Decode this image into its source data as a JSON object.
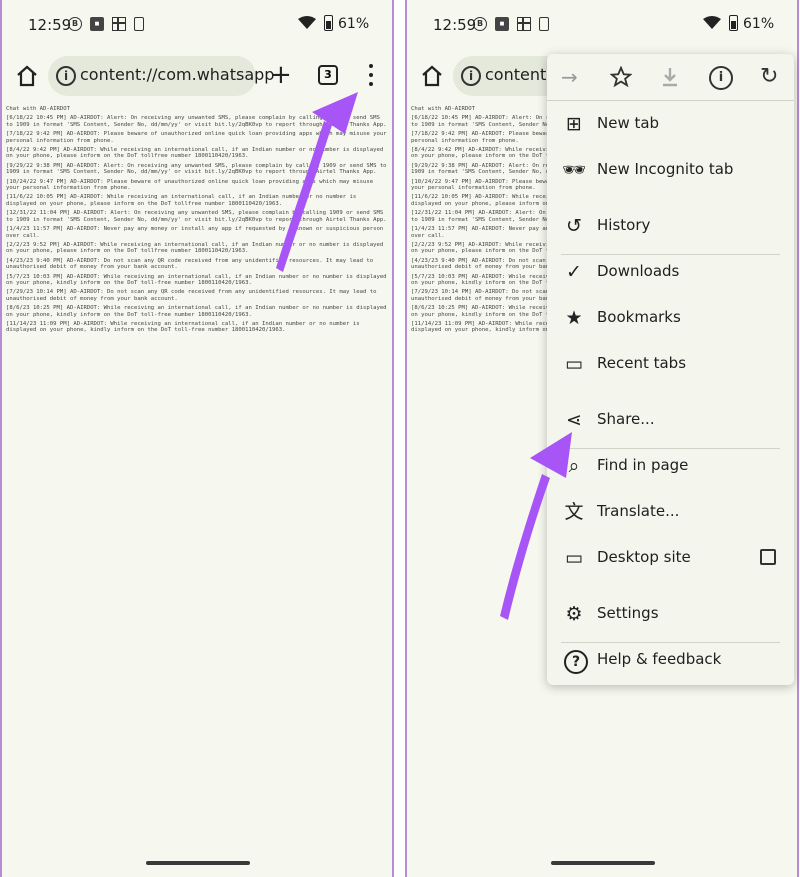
{
  "status": {
    "time": "12:59",
    "battery": "61%"
  },
  "toolbar": {
    "url": "content://com.whatsapp",
    "tab_count": "3"
  },
  "doc_lines": [
    "Chat with AD-AIRDOT",
    "[6/18/22 10:45 PM] AD-AIRDOT: Alert: On receiving any unwanted SMS, please complain by calling 1909 or send SMS to 1909 in format 'SMS Content, Sender No, dd/mm/yy' or visit bit.ly/2qBK0vp to report through Airtel Thanks App.",
    "[7/18/22 9:42 PM] AD-AIRDOT: Please beware of unauthorized online quick loan providing apps which may misuse your personal information from phone.",
    "[8/4/22 9:42 PM] AD-AIRDOT: While receiving an international call, if an Indian number or no number is displayed on your phone, please inform on the DoT tollfree number 1800110420/1963.",
    "[9/29/22 9:38 PM] AD-AIRDOT: Alert: On receiving any unwanted SMS, please complain by calling 1909 or send SMS to 1909 in format 'SMS Content, Sender No, dd/mm/yy' or visit bit.ly/2qBK0vp to report through Airtel Thanks App.",
    "[10/24/22 9:47 PM] AD-AIRDOT: Please beware of unauthorized online quick loan providing apps which may misuse your personal information from phone.",
    "[11/6/22 10:05 PM] AD-AIRDOT: While receiving an international call, if an Indian number or no number is displayed on your phone, please inform on the DoT tollfree number 1800110420/1963.",
    "[12/31/22 11:04 PM] AD-AIRDOT: Alert: On receiving any unwanted SMS, please complain by calling 1909 or send SMS to 1909 in format 'SMS Content, Sender No, dd/mm/yy' or visit bit.ly/2qBK0vp to report through Airtel Thanks App.",
    "[1/4/23 11:57 PM] AD-AIRDOT: Never pay any money or install any app if requested by unknown or suspicious person over call.",
    "[2/2/23 9:52 PM] AD-AIRDOT: While receiving an international call, if an Indian number or no number is displayed on your phone, please inform on the DoT tollfree number 1800110420/1963.",
    "[4/23/23 9:40 PM] AD-AIRDOT: Do not scan any QR code received from any unidentified resources. It may lead to unauthorised debit of money from your bank account.",
    "[5/7/23 10:03 PM] AD-AIRDOT: While receiving an international call, if an Indian number or no number is displayed on your phone, kindly inform on the DoT toll-free number 1800110420/1963.",
    "[7/29/23 10:14 PM] AD-AIRDOT: Do not scan any QR code received from any unidentified resources. It may lead to unauthorised debit of money from your bank account.",
    "[8/6/23 10:25 PM] AD-AIRDOT: While receiving an international call, if an Indian number or no number is displayed on your phone, kindly inform on the DoT toll-free number 1800110420/1963.",
    "[11/14/23 11:09 PM] AD-AIRDOT: While receiving an international call, if an Indian number or no number is displayed on your phone, kindly inform on the DoT toll-free number 1800110420/1963."
  ],
  "menu": {
    "top_icons": [
      "forward-icon",
      "star-icon",
      "download-icon",
      "info-icon",
      "refresh-icon"
    ],
    "items": [
      {
        "label": "New tab",
        "icon": "new-tab-icon"
      },
      {
        "label": "New Incognito tab",
        "icon": "incognito-icon"
      },
      {
        "label": "History",
        "icon": "history-icon"
      },
      {
        "label": "Downloads",
        "icon": "downloads-icon"
      },
      {
        "label": "Bookmarks",
        "icon": "bookmarks-icon"
      },
      {
        "label": "Recent tabs",
        "icon": "recent-tabs-icon"
      },
      {
        "label": "Share...",
        "icon": "share-icon"
      },
      {
        "label": "Find in page",
        "icon": "find-icon"
      },
      {
        "label": "Translate...",
        "icon": "translate-icon"
      },
      {
        "label": "Desktop site",
        "icon": "desktop-icon"
      },
      {
        "label": "Settings",
        "icon": "settings-icon"
      },
      {
        "label": "Help & feedback",
        "icon": "help-icon"
      }
    ]
  },
  "colors": {
    "arrow": "#a855f7",
    "frame": "#b98ad6",
    "background": "#f6f8ef"
  }
}
